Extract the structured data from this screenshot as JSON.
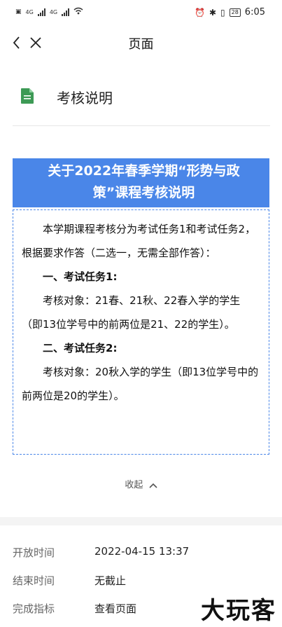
{
  "status_bar": {
    "network_1": "4G",
    "network_2": "4G",
    "battery": "28",
    "time": "6:05"
  },
  "nav": {
    "title": "页面"
  },
  "doc": {
    "icon": "document-icon",
    "title": "考核说明"
  },
  "banner": {
    "line1": "关于2022年春季学期“形势与政",
    "line2": "策”课程考核说明"
  },
  "content": {
    "intro": "本学期课程考核分为考试任务1和考试任务2，根据要求作答（二选一，无需全部作答）：",
    "task1_heading": "一、考试任务1:",
    "task1_text": "考核对象：21春、21秋、22春入学的学生（即13位学号中的前两位是21、22的学生）。",
    "task2_heading": "二、考试任务2:",
    "task2_text": "考核对象：20秋入学的学生（即13位学号中的前两位是20的学生）。"
  },
  "collapse_label": "收起",
  "info": [
    {
      "label": "开放时间",
      "value": "2022-04-15 13:37"
    },
    {
      "label": "结束时间",
      "value": "无截止"
    },
    {
      "label": "完成指标",
      "value": "查看页面"
    }
  ],
  "watermark": "大玩客",
  "colors": {
    "banner": "#4a86e8",
    "doc_icon": "#3d9a55"
  }
}
